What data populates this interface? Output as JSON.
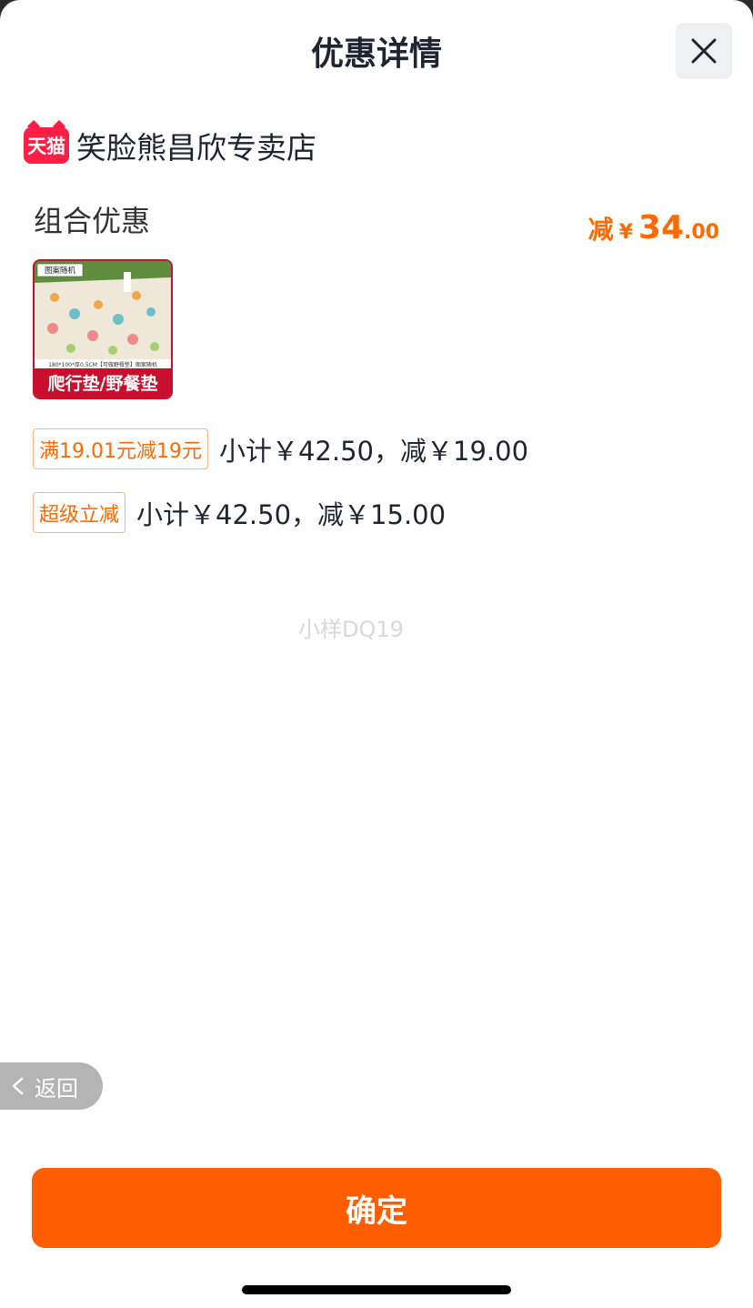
{
  "header": {
    "title": "优惠详情",
    "close_icon": "close-icon"
  },
  "store": {
    "badge": "天猫",
    "name": "笑脸熊昌欣专卖店",
    "badge_color": "#ff1f45"
  },
  "combo": {
    "title": "组合优惠",
    "saving_label": "减",
    "saving_currency": "¥",
    "saving_int": "34",
    "saving_dec": ".00",
    "accent_color": "#ff6a00"
  },
  "product": {
    "tag": "图案随机",
    "spec": "180*100*厚0.5CM【可做野餐垫】图案随机",
    "banner": "爬行垫/野餐垫"
  },
  "rules": [
    {
      "tag": "满19.01元减19元",
      "text": "小计￥42.50，减￥19.00"
    },
    {
      "tag": "超级立减",
      "text": "小计￥42.50，减￥15.00"
    }
  ],
  "watermark": "小样DQ19",
  "back": {
    "label": "返回",
    "icon": "chevron-left-icon"
  },
  "confirm": {
    "label": "确定",
    "color": "#ff5e00"
  }
}
